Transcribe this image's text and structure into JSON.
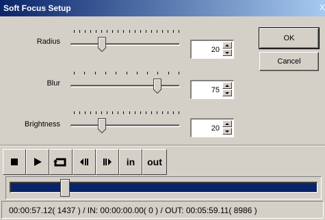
{
  "window": {
    "title": "Soft Focus Setup",
    "close_label": "X"
  },
  "sliders": [
    {
      "label": "Radius",
      "value": "20",
      "level": 20
    },
    {
      "label": "Blur",
      "value": "75",
      "level": 75
    },
    {
      "label": "Brightness",
      "value": "20",
      "level": 20
    }
  ],
  "buttons": {
    "ok_label": "OK",
    "cancel_label": "Cancel"
  },
  "toolbar": {
    "stop_icon": "stop-icon",
    "play_icon": "play-icon",
    "loop_icon": "loop-icon",
    "prev_frame_icon": "prev-frame-icon",
    "next_frame_icon": "next-frame-icon",
    "in_label": "in",
    "out_label": "out"
  },
  "timeline": {
    "position_fraction": 0.16,
    "bar_color": "#0a246a"
  },
  "status": {
    "text": "00:00:57.12( 1437 ) / IN: 00:00:00.00( 0 ) / OUT: 00:05:59.11( 8986 )"
  },
  "colors": {
    "title_start": "#0a246a",
    "title_end": "#a6caf0",
    "face": "#d4d0c8"
  }
}
